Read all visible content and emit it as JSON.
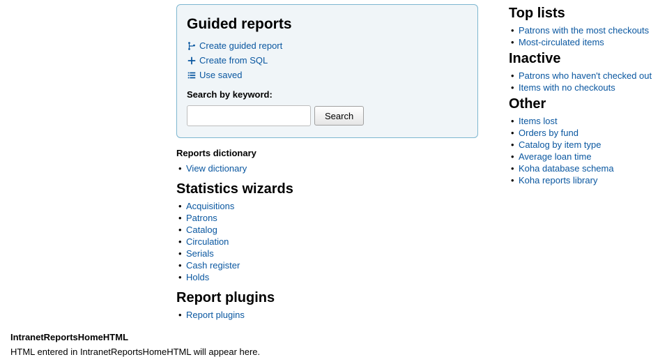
{
  "guided": {
    "title": "Guided reports",
    "create_guided": "Create guided report",
    "create_sql": "Create from SQL",
    "use_saved": "Use saved",
    "search_label": "Search by keyword:",
    "search_button": "Search"
  },
  "dictionary": {
    "heading": "Reports dictionary",
    "items": [
      "View dictionary"
    ]
  },
  "stats_wizards": {
    "heading": "Statistics wizards",
    "items": [
      "Acquisitions",
      "Patrons",
      "Catalog",
      "Circulation",
      "Serials",
      "Cash register",
      "Holds"
    ]
  },
  "report_plugins": {
    "heading": "Report plugins",
    "items": [
      "Report plugins"
    ]
  },
  "top_lists": {
    "heading": "Top lists",
    "items": [
      "Patrons with the most checkouts",
      "Most-circulated items"
    ]
  },
  "inactive": {
    "heading": "Inactive",
    "items": [
      "Patrons who haven't checked out",
      "Items with no checkouts"
    ]
  },
  "other": {
    "heading": "Other",
    "items": [
      "Items lost",
      "Orders by fund",
      "Catalog by item type",
      "Average loan time",
      "Koha database schema",
      "Koha reports library"
    ]
  },
  "footer": {
    "heading": "IntranetReportsHomeHTML",
    "text": "HTML entered in IntranetReportsHomeHTML will appear here."
  }
}
